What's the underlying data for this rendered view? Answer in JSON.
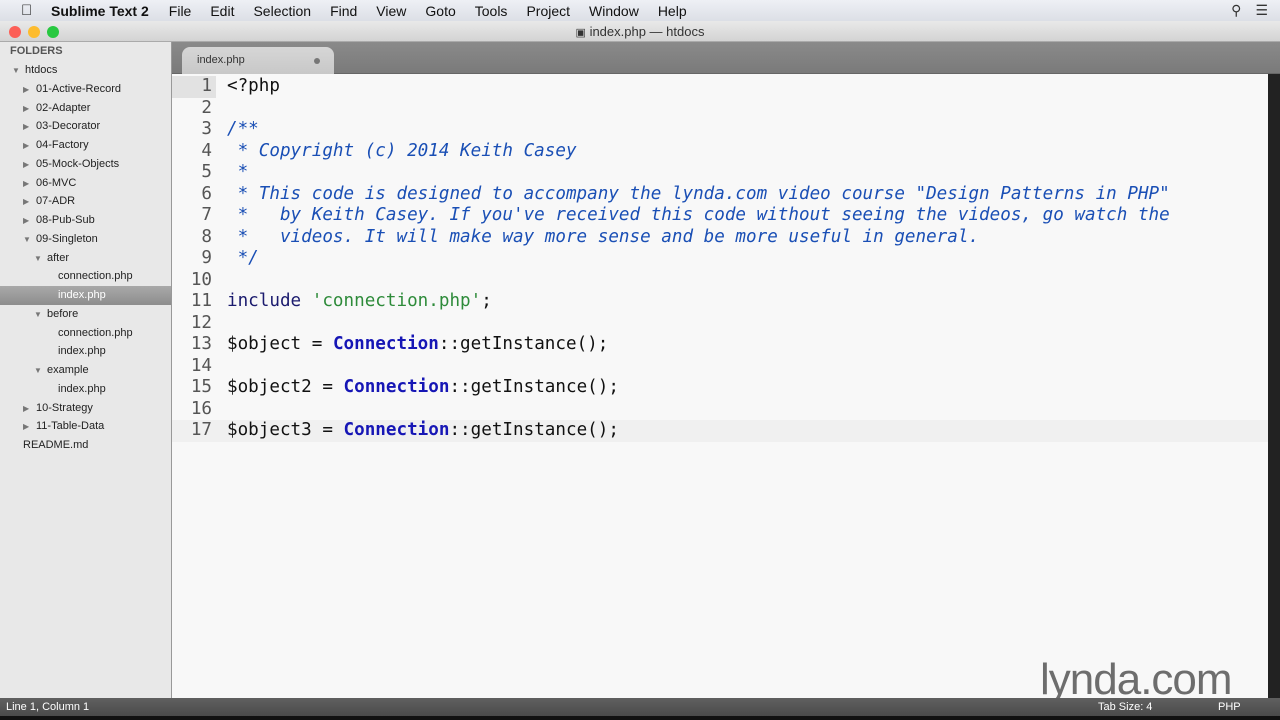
{
  "menubar": {
    "app": "Sublime Text 2",
    "items": [
      "File",
      "Edit",
      "Selection",
      "Find",
      "View",
      "Goto",
      "Tools",
      "Project",
      "Window",
      "Help"
    ]
  },
  "window": {
    "title": "index.php — htdocs"
  },
  "sidebar": {
    "header": "FOLDERS",
    "tree": [
      {
        "label": "htdocs",
        "depth": 0,
        "arrow": "open"
      },
      {
        "label": "01-Active-Record",
        "depth": 1,
        "arrow": "closed"
      },
      {
        "label": "02-Adapter",
        "depth": 1,
        "arrow": "closed"
      },
      {
        "label": "03-Decorator",
        "depth": 1,
        "arrow": "closed"
      },
      {
        "label": "04-Factory",
        "depth": 1,
        "arrow": "closed"
      },
      {
        "label": "05-Mock-Objects",
        "depth": 1,
        "arrow": "closed"
      },
      {
        "label": "06-MVC",
        "depth": 1,
        "arrow": "closed"
      },
      {
        "label": "07-ADR",
        "depth": 1,
        "arrow": "closed"
      },
      {
        "label": "08-Pub-Sub",
        "depth": 1,
        "arrow": "closed"
      },
      {
        "label": "09-Singleton",
        "depth": 1,
        "arrow": "open"
      },
      {
        "label": "after",
        "depth": 2,
        "arrow": "open"
      },
      {
        "label": "connection.php",
        "depth": 3,
        "arrow": "none"
      },
      {
        "label": "index.php",
        "depth": 3,
        "arrow": "none",
        "selected": true
      },
      {
        "label": "before",
        "depth": 2,
        "arrow": "open"
      },
      {
        "label": "connection.php",
        "depth": 3,
        "arrow": "none"
      },
      {
        "label": "index.php",
        "depth": 3,
        "arrow": "none"
      },
      {
        "label": "example",
        "depth": 2,
        "arrow": "open"
      },
      {
        "label": "index.php",
        "depth": 3,
        "arrow": "none"
      },
      {
        "label": "10-Strategy",
        "depth": 1,
        "arrow": "closed"
      },
      {
        "label": "11-Table-Data",
        "depth": 1,
        "arrow": "closed"
      },
      {
        "label": "README.md",
        "depth": 1,
        "arrow": "none"
      }
    ]
  },
  "tab": {
    "label": "index.php"
  },
  "code": [
    [
      [
        "plain",
        "<?php"
      ]
    ],
    [],
    [
      [
        "comment",
        "/**"
      ]
    ],
    [
      [
        "comment",
        " * Copyright (c) 2014 Keith Casey"
      ]
    ],
    [
      [
        "comment",
        " *"
      ]
    ],
    [
      [
        "comment",
        " * This code is designed to accompany the lynda.com video course \"Design Patterns in PHP\""
      ]
    ],
    [
      [
        "comment",
        " *   by Keith Casey. If you've received this code without seeing the videos, go watch the"
      ]
    ],
    [
      [
        "comment",
        " *   videos. It will make way more sense and be more useful in general."
      ]
    ],
    [
      [
        "comment",
        " */"
      ]
    ],
    [],
    [
      [
        "kw",
        "include"
      ],
      [
        "plain",
        " "
      ],
      [
        "str",
        "'connection.php'"
      ],
      [
        "plain",
        ";"
      ]
    ],
    [],
    [
      [
        "plain",
        "$object = "
      ],
      [
        "cls",
        "Connection"
      ],
      [
        "plain",
        "::getInstance();"
      ]
    ],
    [],
    [
      [
        "plain",
        "$object2 = "
      ],
      [
        "cls",
        "Connection"
      ],
      [
        "plain",
        "::getInstance();"
      ]
    ],
    [],
    [
      [
        "plain",
        "$object3 = "
      ],
      [
        "cls",
        "Connection"
      ],
      [
        "plain",
        "::getInstance();"
      ]
    ]
  ],
  "status": {
    "position": "Line 1, Column 1",
    "tab_size": "Tab Size: 4",
    "syntax": "PHP"
  },
  "watermark": "lynda.com"
}
